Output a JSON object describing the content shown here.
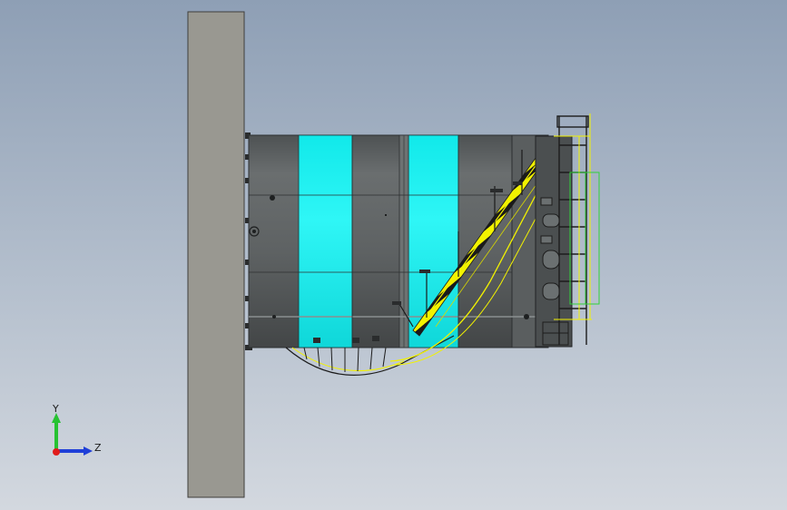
{
  "colors": {
    "background_top": "#8e9fb5",
    "background_bottom": "#d3d8df",
    "wall": "#999891",
    "tank_body": "#5b5f60",
    "tank_band": "#00ffff",
    "stair_rail": "#f2f200",
    "stair_stripe": "#1a1a1a",
    "railing_green": "#31d13a",
    "axis_y": "#27c232",
    "axis_z": "#1f3fd8",
    "axis_x": "#e01b1b"
  },
  "triad": {
    "y_label": "Y",
    "z_label": "Z"
  }
}
